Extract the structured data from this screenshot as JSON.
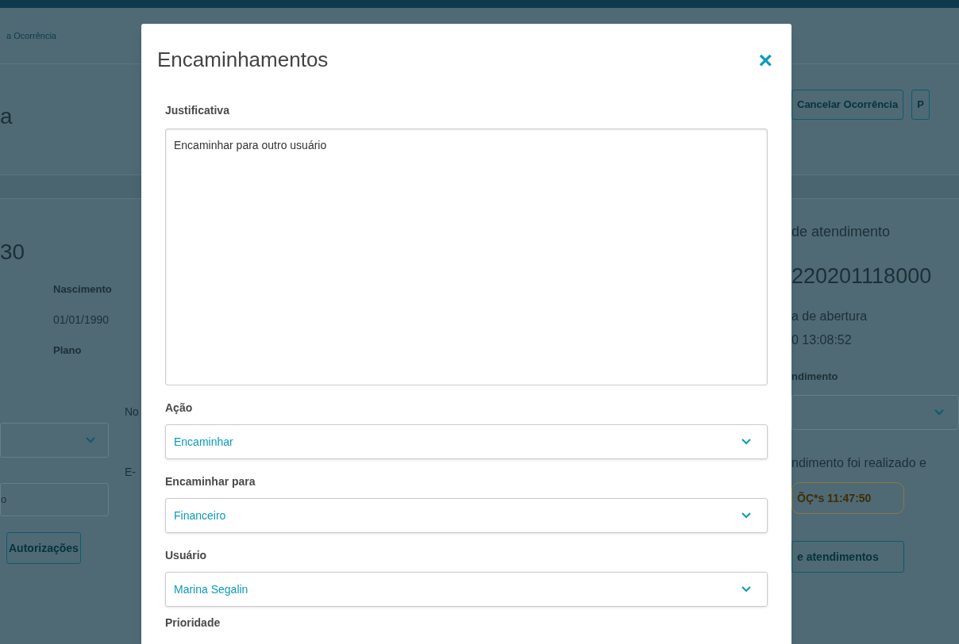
{
  "page": {
    "breadcrumb": "a Ocorrência",
    "title": "a",
    "header_buttons": [
      "Cancelar Ocorrência",
      "P"
    ],
    "left": {
      "number": "30",
      "fields": [
        {
          "label": "Nascimento",
          "value": "01/01/1990"
        },
        {
          "label": "Plano"
        }
      ],
      "label_2": "No",
      "label_3": "E-",
      "input_value": "o",
      "button": "Autorizações"
    },
    "right": {
      "caption": "de atendimento",
      "protocol": "220201118000",
      "opened_label": "a de abertura",
      "opened_value": "0 13:08:52",
      "select_label": "ndimento",
      "note": "ndimento foi realizado e",
      "badge": "ÕÇ*s 11:47:50",
      "button": "e atendimentos"
    }
  },
  "modal": {
    "title": "Encaminhamentos",
    "close": "×",
    "justification": {
      "label": "Justificativa",
      "value": "Encaminhar para outro usuário"
    },
    "selects": [
      {
        "label": "Ação",
        "value": "Encaminhar"
      },
      {
        "label": "Encaminhar para",
        "value": "Financeiro"
      },
      {
        "label": "Usuário",
        "value": "Marina Segalin"
      }
    ],
    "next_label": "Prioridade"
  }
}
